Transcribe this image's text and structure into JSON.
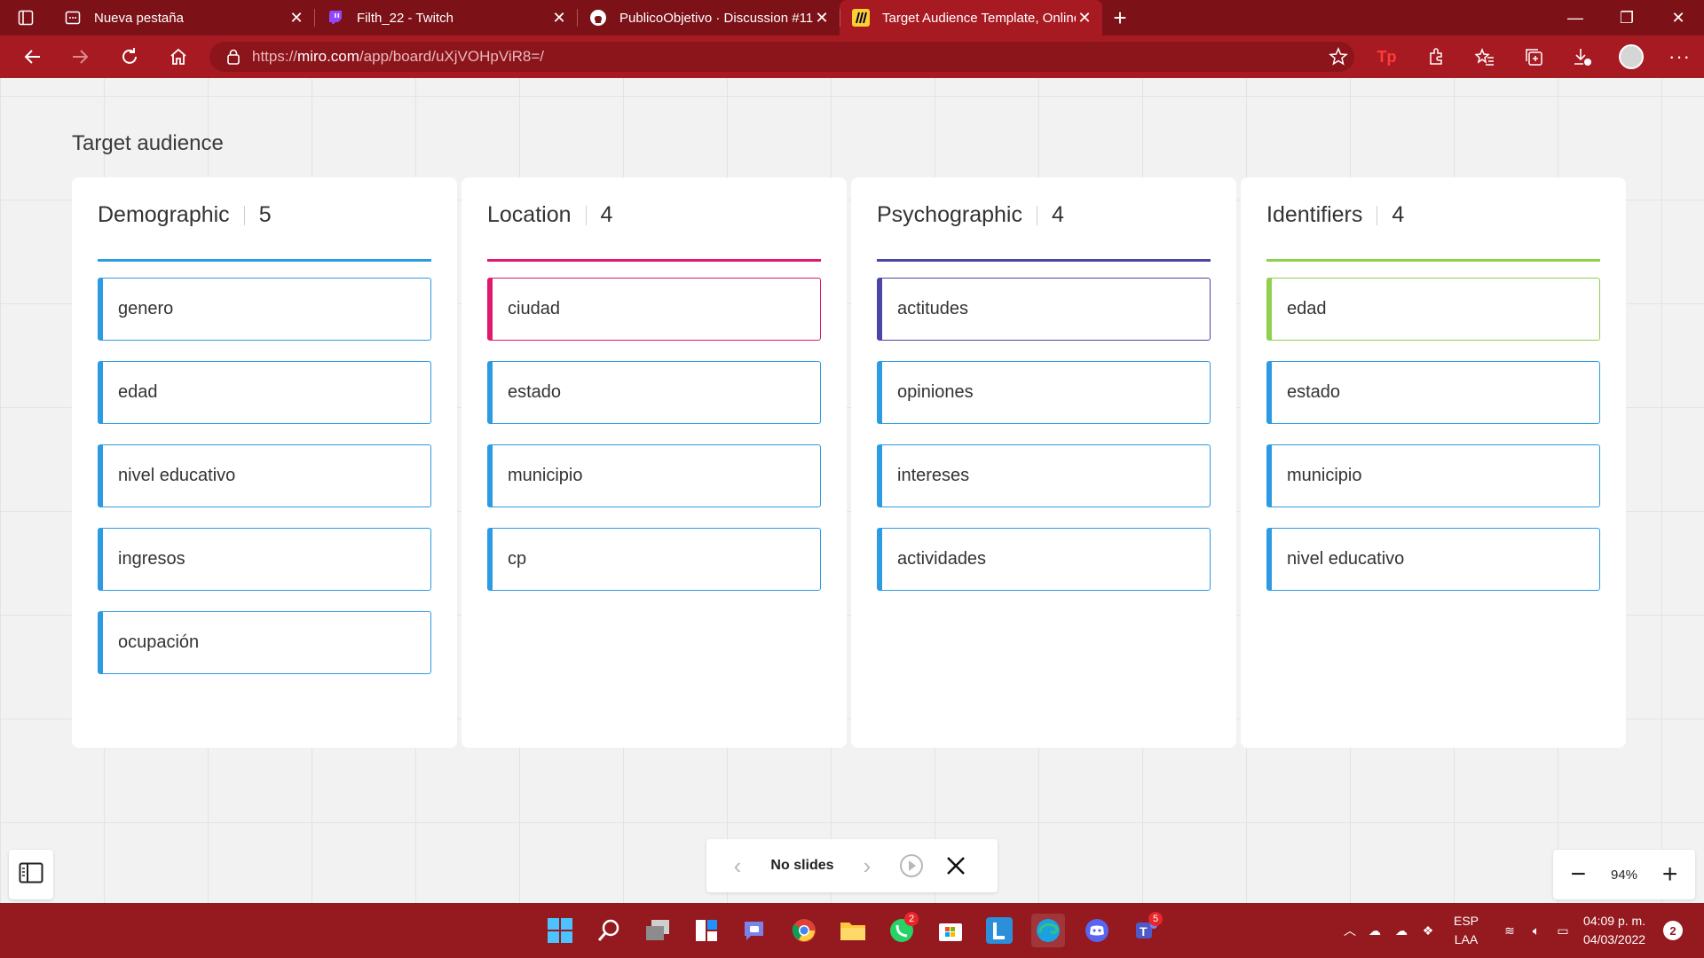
{
  "browser": {
    "tabs": [
      {
        "title": "Nueva pestaña",
        "icon": "newtab-icon"
      },
      {
        "title": "Filth_22 - Twitch",
        "icon": "twitch-icon"
      },
      {
        "title": "PublicoObjetivo · Discussion #11",
        "icon": "github-icon"
      },
      {
        "title": "Target Audience Template, Online",
        "icon": "miro-icon"
      }
    ],
    "new_tab": "+",
    "url_scheme": "https://",
    "url_host": "miro.com",
    "url_path": "/app/board/uXjVOHpViR8=/",
    "colors": {
      "frame": "#7d1118",
      "toolbar": "#a81a22"
    }
  },
  "board": {
    "title": "Target audience",
    "columns": [
      {
        "name": "Demographic",
        "count": "5",
        "accent": "#2d9be3",
        "cards": [
          "genero",
          "edad",
          "nivel educativo",
          "ingresos",
          "ocupación"
        ],
        "card_accents": [
          "#2d9be3",
          "#2d9be3",
          "#2d9be3",
          "#2d9be3",
          "#2d9be3"
        ]
      },
      {
        "name": "Location",
        "count": "4",
        "accent": "#e0196e",
        "cards": [
          "ciudad",
          "estado",
          "municipio",
          "cp"
        ],
        "card_accents": [
          "#e0196e",
          "#2d9be3",
          "#2d9be3",
          "#2d9be3"
        ]
      },
      {
        "name": "Psychographic",
        "count": "4",
        "accent": "#4b45a8",
        "cards": [
          "actitudes",
          "opiniones",
          "intereses",
          "actividades"
        ],
        "card_accents": [
          "#4b45a8",
          "#2d9be3",
          "#2d9be3",
          "#2d9be3"
        ]
      },
      {
        "name": "Identifiers",
        "count": "4",
        "accent": "#8fd14f",
        "cards": [
          "edad",
          "estado",
          "municipio",
          "nivel educativo"
        ],
        "card_accents": [
          "#8fd14f",
          "#2d9be3",
          "#2d9be3",
          "#2d9be3"
        ]
      }
    ]
  },
  "slides": {
    "label": "No slides"
  },
  "zoom": {
    "value": "94%",
    "minus": "−",
    "plus": "+"
  },
  "taskbar": {
    "whatsapp_badge": "2",
    "teams_badge": "5",
    "lang_line1": "ESP",
    "lang_line2": "LAA",
    "time": "04:09 p. m.",
    "date": "04/03/2022",
    "notifications": "2"
  }
}
